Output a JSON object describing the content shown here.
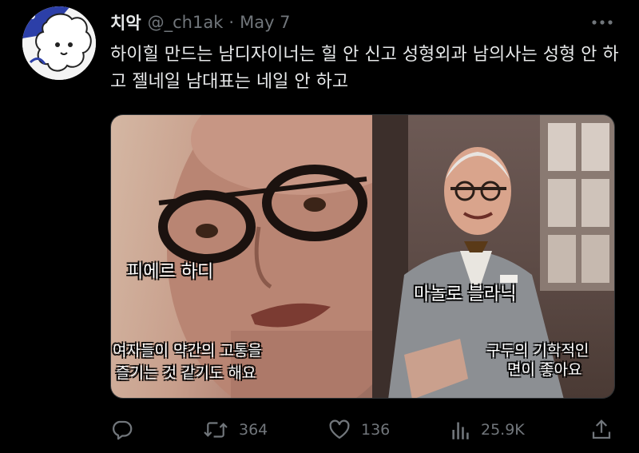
{
  "tweet": {
    "display_name": "치악",
    "handle": "@_ch1ak",
    "separator": "·",
    "date": "May 7",
    "text": "하이힐 만드는 남디자이너는 힐 안 신고 성형외과 남의사는 성형 안 하고 젤네일 남대표는 네일 안 하고"
  },
  "media": {
    "left_caption_name": "피에르 하디",
    "left_caption_sub_1": "여자들이 약간의 고통을",
    "left_caption_sub_2": "즐기는 것 같기도 해요",
    "right_caption_name": "마놀로 블라닉",
    "right_caption_sub_1": "구두의 기학적인",
    "right_caption_sub_2": "면이 좋아요"
  },
  "actions": {
    "reply_icon": "reply-icon",
    "retweet_icon": "retweet-icon",
    "retweet_count": "364",
    "like_icon": "heart-icon",
    "like_count": "136",
    "views_icon": "views-icon",
    "views_count": "25.9K",
    "share_icon": "share-icon"
  },
  "colors": {
    "background": "#000000",
    "text": "#e7e9ea",
    "muted": "#71767b"
  }
}
